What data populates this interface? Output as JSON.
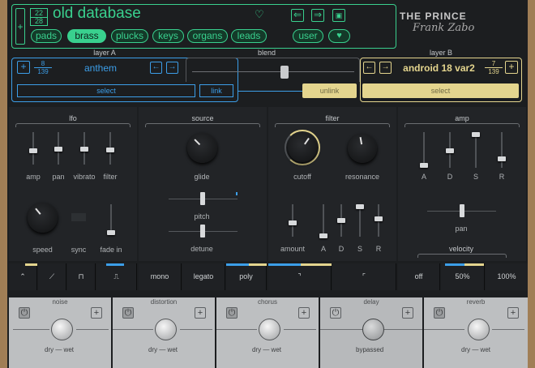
{
  "preset": {
    "index": "22",
    "total": "28",
    "name": "old database",
    "add": "+",
    "prev": "⇐",
    "next": "⇒",
    "save": "💾"
  },
  "categories": [
    "pads",
    "brass",
    "plucks",
    "keys",
    "organs",
    "leads"
  ],
  "active_category": "brass",
  "user": "user",
  "logo": {
    "text": "THE PRINCE",
    "signature": "Frank Zabo"
  },
  "layer_a": {
    "title": "layer A",
    "index": "8",
    "total": "139",
    "name": "anthem",
    "select": "select",
    "link": "link"
  },
  "blend": {
    "title": "blend",
    "value": 0.6
  },
  "layer_b": {
    "title": "layer B",
    "index": "7",
    "total": "139",
    "name": "android 18 var2",
    "select": "select",
    "unlink": "unlink"
  },
  "sections": {
    "lfo": "lfo",
    "source": "source",
    "filter": "filter",
    "amp": "amp"
  },
  "lfo": {
    "labels": [
      "amp",
      "pan",
      "vibrato",
      "filter"
    ],
    "speed": "speed",
    "sync": "sync",
    "fade_in": "fade in"
  },
  "source": {
    "glide": "glide",
    "pitch": "pitch",
    "detune": "detune"
  },
  "filter": {
    "cutoff": "cutoff",
    "resonance": "resonance",
    "amount": "amount",
    "adsr": [
      "A",
      "D",
      "S",
      "R"
    ]
  },
  "amp": {
    "adsr": [
      "A",
      "D",
      "S",
      "R"
    ],
    "pan": "pan",
    "velocity": "velocity"
  },
  "modes": {
    "mono": "mono",
    "legato": "legato",
    "poly": "poly"
  },
  "vel": {
    "off": "off",
    "mid": "50%",
    "full": "100%"
  },
  "fx": [
    {
      "title": "noise",
      "dw": "dry — wet"
    },
    {
      "title": "distortion",
      "dw": "dry — wet"
    },
    {
      "title": "chorus",
      "dw": "dry — wet"
    },
    {
      "title": "delay",
      "dw": "bypassed"
    },
    {
      "title": "reverb",
      "dw": "dry — wet"
    }
  ],
  "colors": {
    "green": "#39d08e",
    "blue": "#3c9ee8",
    "yellow": "#e4d58e",
    "panel": "#222427"
  }
}
